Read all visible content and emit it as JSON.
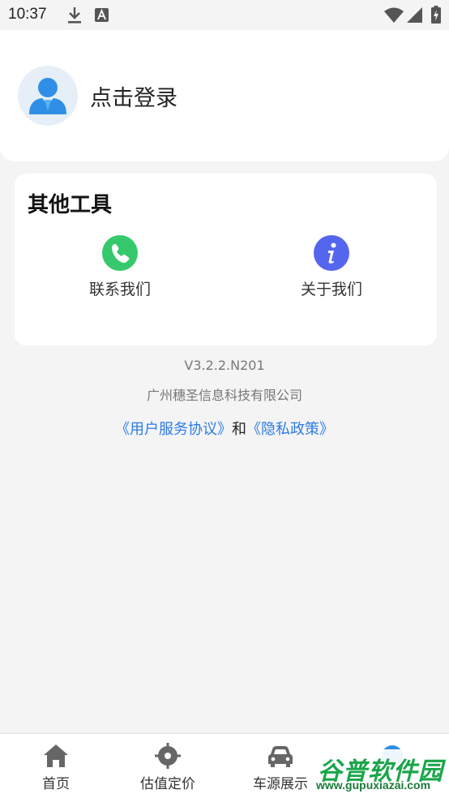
{
  "status_bar": {
    "time": "10:37"
  },
  "profile": {
    "login_label": "点击登录"
  },
  "tools": {
    "title": "其他工具",
    "items": [
      {
        "label": "联系我们",
        "icon": "phone-icon",
        "color": "#35c96b"
      },
      {
        "label": "关于我们",
        "icon": "info-icon",
        "color": "#5566ee"
      }
    ]
  },
  "footer": {
    "version": "V3.2.2.N201",
    "company": "广州穗圣信息科技有限公司",
    "user_agreement": "《用户服务协议》",
    "and": "和",
    "privacy_policy": "《隐私政策》",
    "link_color": "#2c7be5"
  },
  "bottom_nav": {
    "items": [
      {
        "label": "首页",
        "icon": "home-icon"
      },
      {
        "label": "估值定价",
        "icon": "target-icon"
      },
      {
        "label": "车源展示",
        "icon": "car-icon"
      }
    ]
  },
  "watermark": {
    "name": "谷普软件园",
    "url": "www.gupuxiazai.com"
  }
}
